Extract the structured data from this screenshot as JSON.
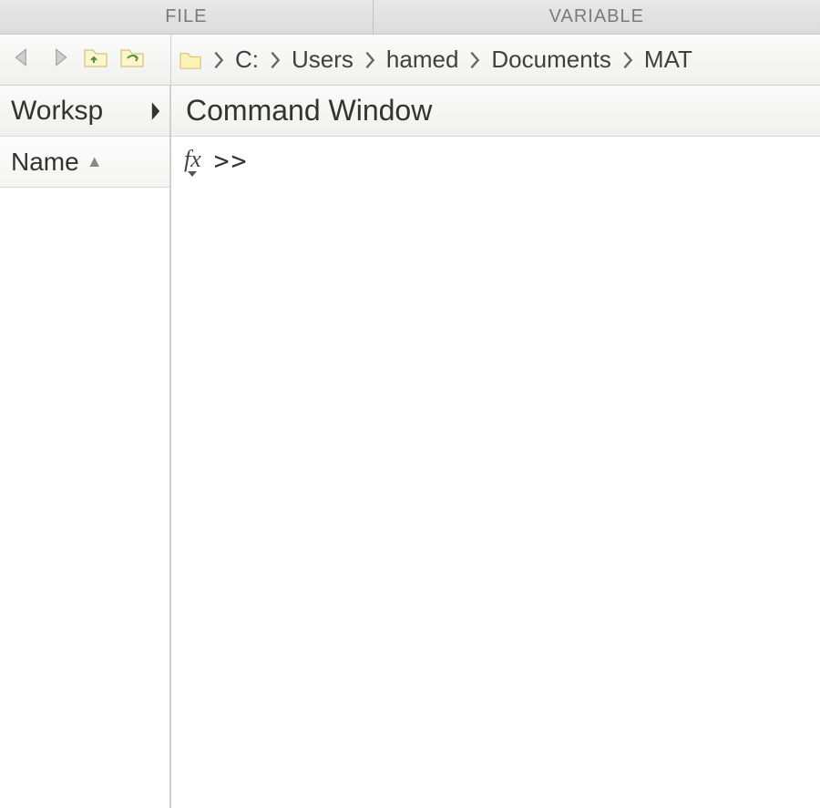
{
  "tabs": {
    "file": "FILE",
    "variable": "VARIABLE"
  },
  "path": {
    "segments": [
      "C:",
      "Users",
      "hamed",
      "Documents",
      "MAT"
    ]
  },
  "workspace": {
    "title": "Worksp",
    "column": "Name",
    "items": []
  },
  "command": {
    "title": "Command Window",
    "fx_label": "fx",
    "prompt": ">>",
    "input_value": ""
  }
}
